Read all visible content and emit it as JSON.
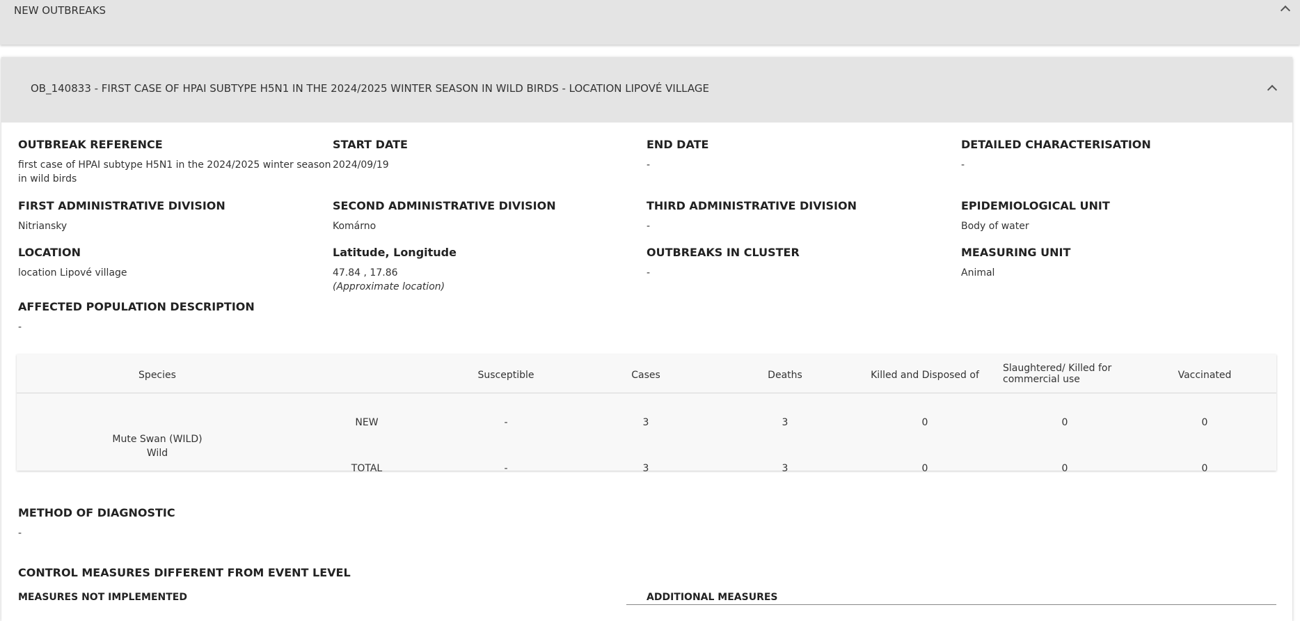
{
  "new_outbreaks_panel": {
    "title": "NEW OUTBREAKS"
  },
  "outbreak": {
    "title": "OB_140833 - FIRST CASE OF HPAI SUBTYPE H5N1 IN THE 2024/2025 WINTER SEASON IN WILD BIRDS - LOCATION LIPOVÉ VILLAGE",
    "fields": {
      "outbreak_reference": {
        "label": "OUTBREAK REFERENCE",
        "value": "first case of HPAI subtype H5N1 in the 2024/2025 winter season in wild birds"
      },
      "start_date": {
        "label": "START DATE",
        "value": "2024/09/19"
      },
      "end_date": {
        "label": "END DATE",
        "value": "-"
      },
      "detailed_characterisation": {
        "label": "DETAILED CHARACTERISATION",
        "value": "-"
      },
      "first_admin_division": {
        "label": "FIRST ADMINISTRATIVE DIVISION",
        "value": "Nitriansky"
      },
      "second_admin_division": {
        "label": "SECOND ADMINISTRATIVE DIVISION",
        "value": "Komárno"
      },
      "third_admin_division": {
        "label": "THIRD ADMINISTRATIVE DIVISION",
        "value": "-"
      },
      "epidemiological_unit": {
        "label": "EPIDEMIOLOGICAL UNIT",
        "value": "Body of water"
      },
      "location": {
        "label": "LOCATION",
        "value": "location Lipové village"
      },
      "lat_long": {
        "label": "Latitude, Longitude",
        "value": "47.84 , 17.86",
        "note": "(Approximate location)"
      },
      "outbreaks_in_cluster": {
        "label": "OUTBREAKS IN CLUSTER",
        "value": "-"
      },
      "measuring_unit": {
        "label": "MEASURING UNIT",
        "value": "Animal"
      },
      "affected_population": {
        "label": "AFFECTED POPULATION DESCRIPTION",
        "value": "-"
      },
      "method_of_diagnostic": {
        "label": "METHOD OF DIAGNOSTIC",
        "value": "-"
      }
    },
    "species_table": {
      "headers": {
        "species": "Species",
        "susceptible": "Susceptible",
        "cases": "Cases",
        "deaths": "Deaths",
        "killed_disposed": "Killed and Disposed of",
        "slaughtered": "Slaughtered/ Killed for commercial use",
        "vaccinated": "Vaccinated"
      },
      "species_name": "Mute Swan (WILD)",
      "species_type": "Wild",
      "rows": {
        "new": {
          "label": "NEW",
          "susceptible": "-",
          "cases": "3",
          "deaths": "3",
          "killed_disposed": "0",
          "slaughtered": "0",
          "vaccinated": "0"
        },
        "total": {
          "label": "TOTAL",
          "susceptible": "-",
          "cases": "3",
          "deaths": "3",
          "killed_disposed": "0",
          "slaughtered": "0",
          "vaccinated": "0"
        }
      }
    },
    "control_measures": {
      "title": "CONTROL MEASURES DIFFERENT FROM EVENT LEVEL",
      "not_implemented_label": "MEASURES NOT IMPLEMENTED",
      "additional_label": "ADDITIONAL MEASURES"
    }
  }
}
